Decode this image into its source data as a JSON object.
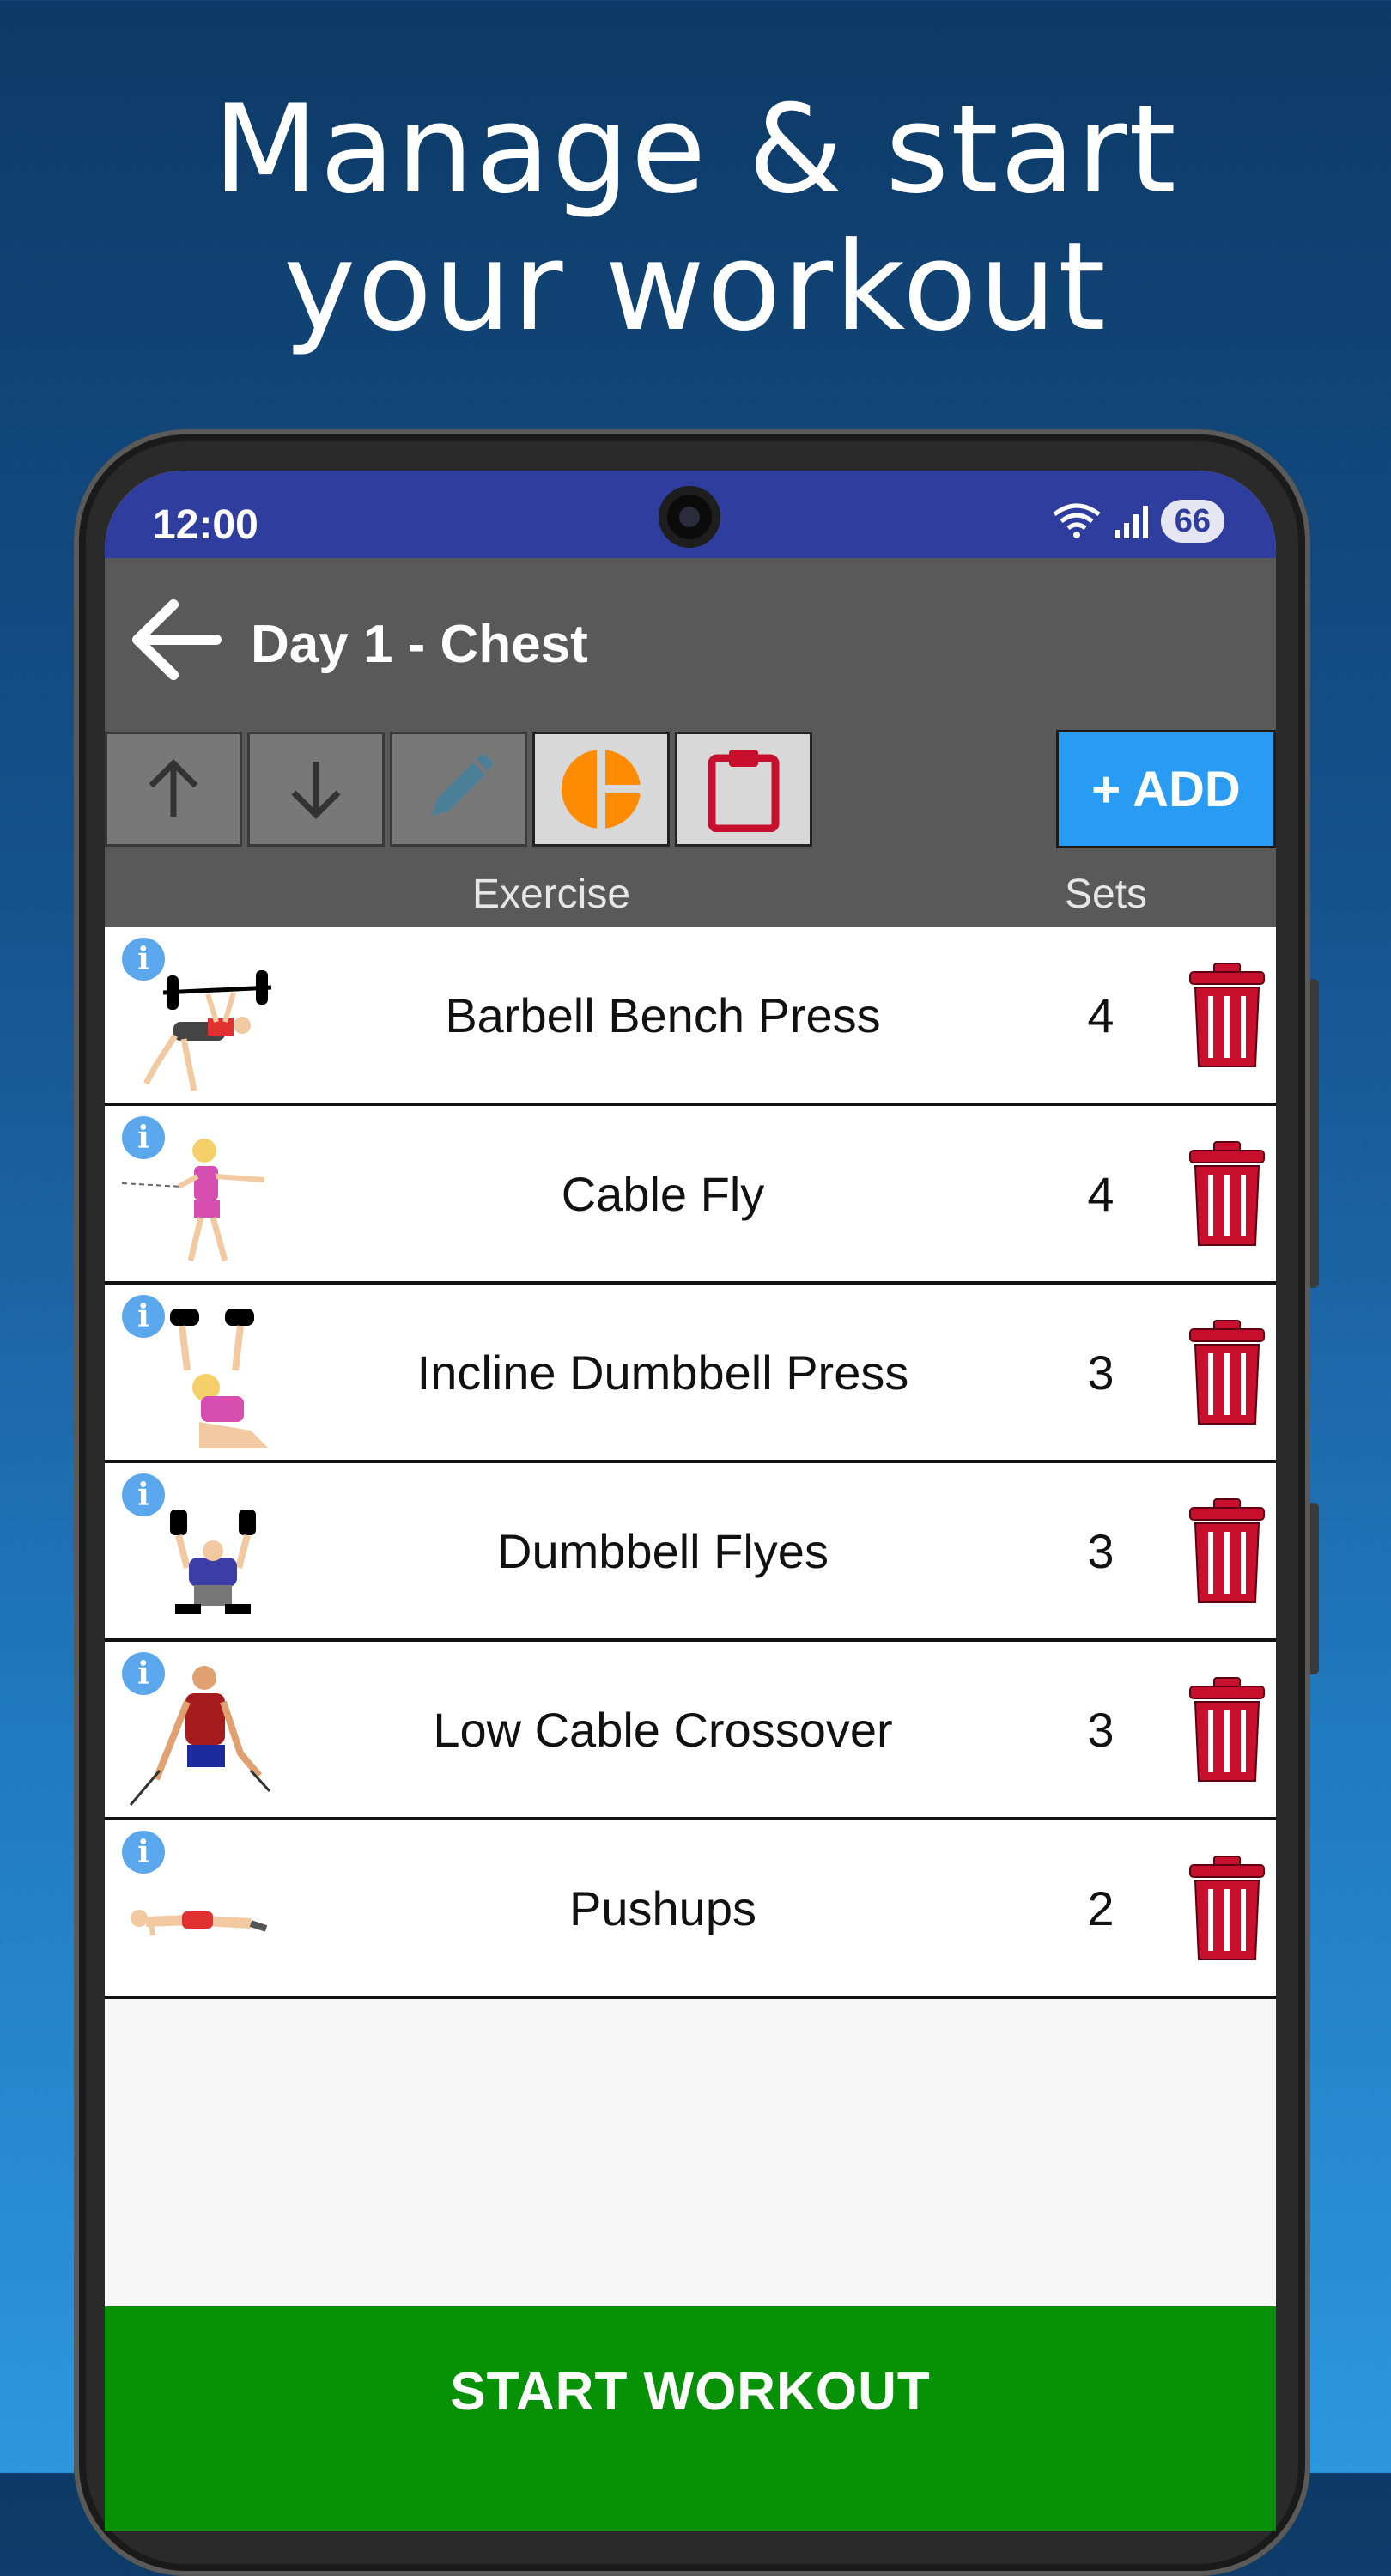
{
  "headline": {
    "line1": "Manage & start",
    "line2": "your workout"
  },
  "status_bar": {
    "time": "12:00",
    "battery": "66"
  },
  "app_bar": {
    "title": "Day 1 - Chest"
  },
  "toolbar": {
    "add_label": "+ ADD"
  },
  "columns": {
    "exercise": "Exercise",
    "sets": "Sets"
  },
  "exercises": [
    {
      "name": "Barbell Bench Press",
      "sets": "4"
    },
    {
      "name": "Cable Fly",
      "sets": "4"
    },
    {
      "name": "Incline Dumbbell Press",
      "sets": "3"
    },
    {
      "name": "Dumbbell Flyes",
      "sets": "3"
    },
    {
      "name": "Low Cable Crossover",
      "sets": "3"
    },
    {
      "name": "Pushups",
      "sets": "2"
    }
  ],
  "start_label": "START WORKOUT",
  "colors": {
    "status_bar": "#2f3e9e",
    "app_bar": "#595959",
    "add_button": "#2a9bf3",
    "trash": "#c8102e",
    "start_button": "#079107",
    "stats_icon": "#ff8c00",
    "info_icon": "#5aa7ee"
  }
}
